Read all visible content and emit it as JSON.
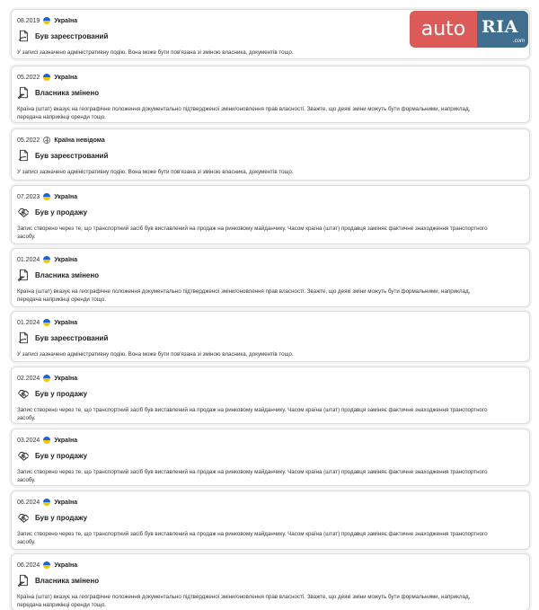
{
  "logo": {
    "part1": "auto",
    "part2": "RIA",
    "part3": ".com"
  },
  "history": [
    {
      "date": "08.2019",
      "flag": "ua",
      "country": "Україна",
      "icon": "registered-icon",
      "title": "Був зареєстрований",
      "desc": "У записі зазначено адміністративну подію. Вона може бути пов'язана зі зміною власника, документів тощо."
    },
    {
      "date": "05.2022",
      "flag": "ua",
      "country": "Україна",
      "icon": "owner-changed-icon",
      "title": "Власника змінено",
      "desc": "Країна (штат) вказує на географічне положення документально підтвердженої зміни/оновлення прав власності. Зважте, що деякі зміни можуть бути формальними, наприклад, передача наприкінці оренди тощо."
    },
    {
      "date": "05.2022",
      "flag": "unknown",
      "country": "Країна невідома",
      "icon": "registered-icon",
      "title": "Був зареєстрований",
      "desc": "У записі зазначено адміністративну подію. Вона може бути пов'язана зі зміною власника, документів тощо."
    },
    {
      "date": "07.2023",
      "flag": "ua",
      "country": "Україна",
      "icon": "for-sale-icon",
      "title": "Був у продажу",
      "desc": "Запис створено через те, що транспортний засіб був виставлений на продаж на ринковому майданчику. Часом країна (штат) продавця заміняє фактичне знаходження транспортного засобу."
    },
    {
      "date": "01.2024",
      "flag": "ua",
      "country": "Україна",
      "icon": "owner-changed-icon",
      "title": "Власника змінено",
      "desc": "Країна (штат) вказує на географічне положення документально підтвердженої зміни/оновлення прав власності. Зважте, що деякі зміни можуть бути формальними, наприклад, передача наприкінці оренди тощо."
    },
    {
      "date": "01.2024",
      "flag": "ua",
      "country": "Україна",
      "icon": "registered-icon",
      "title": "Був зареєстрований",
      "desc": "У записі зазначено адміністративну подію. Вона може бути пов'язана зі зміною власника, документів тощо."
    },
    {
      "date": "02.2024",
      "flag": "ua",
      "country": "Україна",
      "icon": "for-sale-icon",
      "title": "Був у продажу",
      "desc": "Запис створено через те, що транспортний засіб був виставлений на продаж на ринковому майданчику. Часом країна (штат) продавця заміняє фактичне знаходження транспортного засобу."
    },
    {
      "date": "03.2024",
      "flag": "ua",
      "country": "Україна",
      "icon": "for-sale-icon",
      "title": "Був у продажу",
      "desc": "Запис створено через те, що транспортний засіб був виставлений на продаж на ринковому майданчику. Часом країна (штат) продавця заміняє фактичне знаходження транспортного засобу."
    },
    {
      "date": "06.2024",
      "flag": "ua",
      "country": "Україна",
      "icon": "for-sale-icon",
      "title": "Був у продажу",
      "desc": "Запис створено через те, що транспортний засіб був виставлений на продаж на ринковому майданчику. Часом країна (штат) продавця заміняє фактичне знаходження транспортного засобу."
    },
    {
      "date": "06.2024",
      "flag": "ua",
      "country": "Україна",
      "icon": "owner-changed-icon",
      "title": "Власника змінено",
      "desc": "Країна (штат) вказує на географічне положення документально підтвердженої зміни/оновлення прав власності. Зважте, що деякі зміни можуть бути формальними, наприклад, передача наприкінці оренди тощо."
    }
  ]
}
